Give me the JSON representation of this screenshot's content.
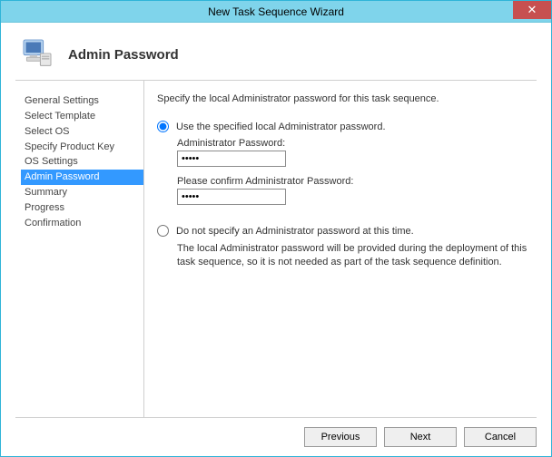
{
  "window": {
    "title": "New Task Sequence Wizard",
    "close_symbol": "✕"
  },
  "header": {
    "title": "Admin Password"
  },
  "sidebar": {
    "items": [
      {
        "label": "General Settings",
        "selected": false
      },
      {
        "label": "Select Template",
        "selected": false
      },
      {
        "label": "Select OS",
        "selected": false
      },
      {
        "label": "Specify Product Key",
        "selected": false
      },
      {
        "label": "OS Settings",
        "selected": false
      },
      {
        "label": "Admin Password",
        "selected": true
      },
      {
        "label": "Summary",
        "selected": false
      },
      {
        "label": "Progress",
        "selected": false
      },
      {
        "label": "Confirmation",
        "selected": false
      }
    ]
  },
  "content": {
    "intro": "Specify the local Administrator password for this task sequence.",
    "option1": {
      "label": "Use the specified local Administrator password.",
      "checked": true,
      "pwd_label": "Administrator Password:",
      "pwd_value": "•••••",
      "confirm_label": "Please confirm Administrator Password:",
      "confirm_value": "•••••"
    },
    "option2": {
      "label": "Do not specify an Administrator password at this time.",
      "checked": false,
      "note": "The local Administrator password will be provided during the deployment of this task sequence, so it is not needed as part of the task sequence definition."
    }
  },
  "footer": {
    "previous": "Previous",
    "next": "Next",
    "cancel": "Cancel"
  }
}
